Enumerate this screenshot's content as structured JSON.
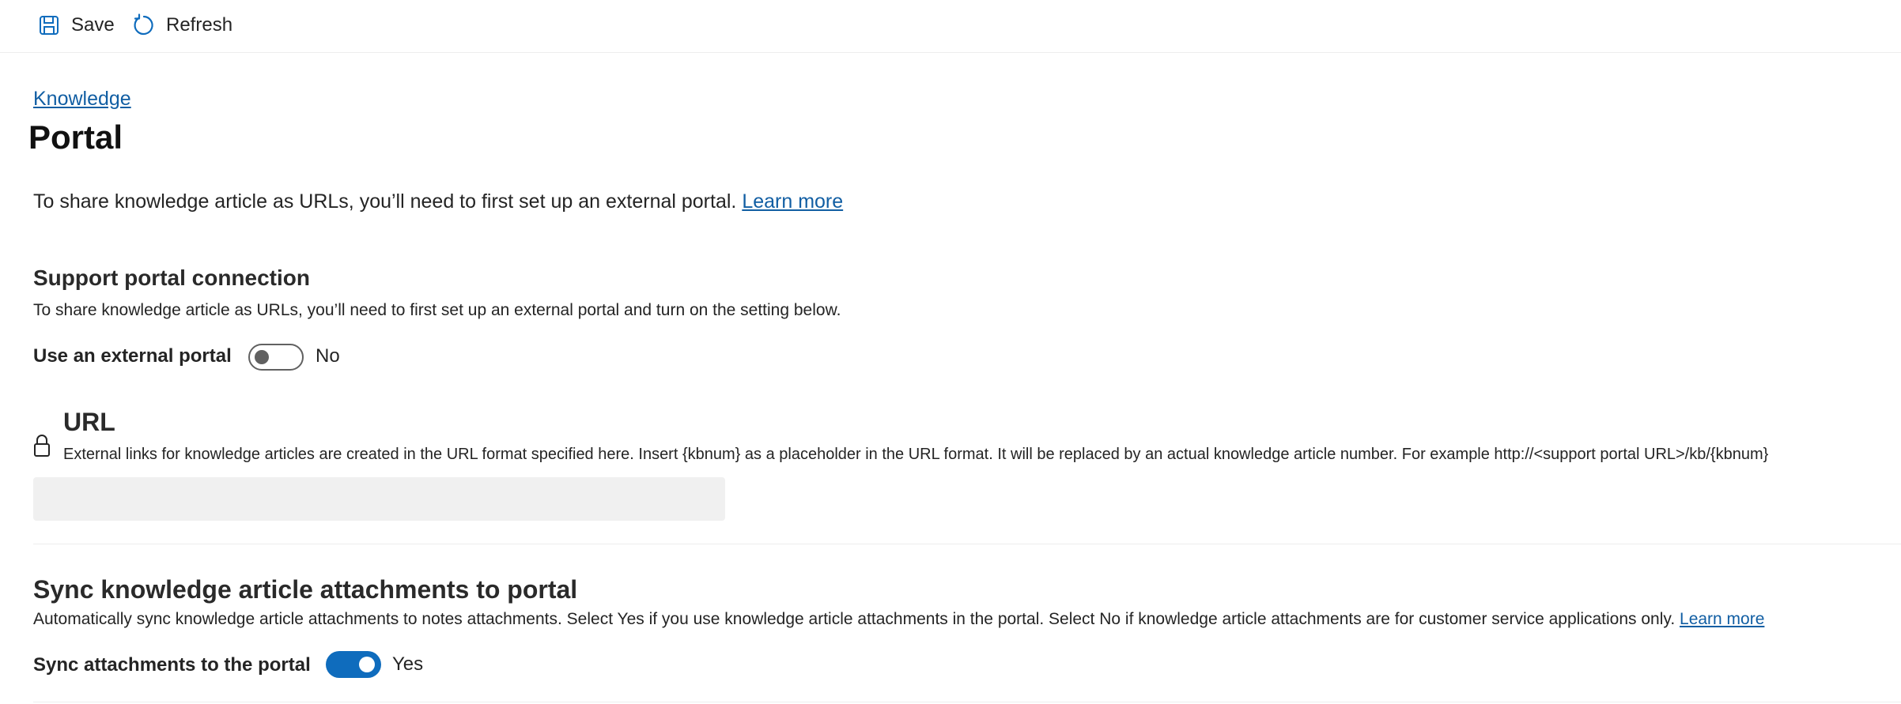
{
  "toolbar": {
    "save_label": "Save",
    "save_icon": "floppy-disk-icon",
    "refresh_label": "Refresh",
    "refresh_icon": "refresh-icon"
  },
  "breadcrumb": {
    "label": "Knowledge"
  },
  "page": {
    "title": "Portal",
    "intro_text": "To share knowledge article as URLs, you’ll need to first set up an external portal.",
    "intro_link": "Learn more"
  },
  "support_portal": {
    "title": "Support portal connection",
    "description": "To share knowledge article as URLs, you’ll need to first set up an external portal and turn on the setting below.",
    "toggle_label": "Use an external portal",
    "toggle_state": "No",
    "toggle_on": false
  },
  "url_field": {
    "title": "URL",
    "lock_icon": "lock-icon",
    "description": "External links for knowledge articles are created in the URL format specified here. Insert {kbnum} as a placeholder in the URL format. It will be replaced by an actual knowledge article number. For example http://<support portal URL>/kb/{kbnum}",
    "value": ""
  },
  "sync_attachments": {
    "title": "Sync knowledge article attachments to portal",
    "description": "Automatically sync knowledge article attachments to notes attachments. Select Yes if you use knowledge article attachments in the portal. Select No if knowledge article attachments are for customer service applications only.",
    "description_link": "Learn more",
    "toggle_label": "Sync attachments to the portal",
    "toggle_state": "Yes",
    "toggle_on": true
  },
  "colors": {
    "accent": "#0f6cbd",
    "link": "#115ea3",
    "text": "#242424",
    "input_bg": "#f0f0f0",
    "divider": "#ededed"
  }
}
